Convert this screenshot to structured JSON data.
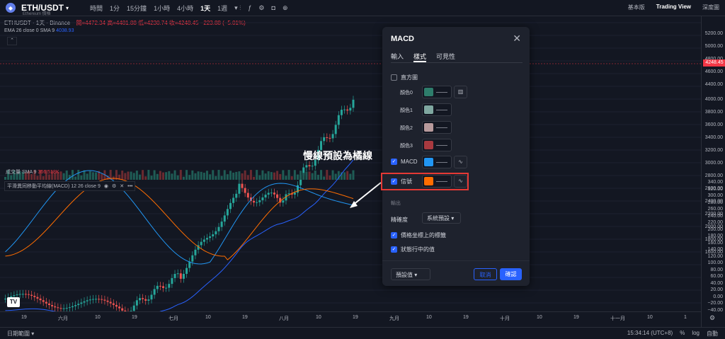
{
  "header": {
    "symbol": "ETH/USDT",
    "symbol_sub": "Ethereum 價格",
    "symbol_icon": "ethereum-logo",
    "timeframes": [
      "時間",
      "1分",
      "15分鐘",
      "1小時",
      "4小時",
      "1天",
      "1週"
    ],
    "active_timeframe": "1天",
    "right": {
      "basic": "基本版",
      "tv": "Trading View",
      "depth": "深度圖"
    }
  },
  "legend": {
    "pair": "ETHUSDT · 1天 · Binance",
    "ohlc": "開=4472.34 高=4481.88 低=4230.74 收=4248.45 −223.88 (−5.01%)",
    "ema": "EMA 26 close 0 SMA 9",
    "ema_value": "4038.93"
  },
  "volume_label": "成交量 SMA 9",
  "volume_value": "366.518K",
  "macd_label": "平滑異同移動平均線(MACD) 12 26 close 9",
  "price_axis": [
    "5200.00",
    "5000.00",
    "4800.00",
    "4600.00",
    "4400.00",
    "4248.45",
    "4000.00",
    "3800.00",
    "3600.00",
    "3400.00",
    "3200.00",
    "3000.00",
    "2800.00",
    "2600.00",
    "2400.00",
    "2200.00",
    "2000.00",
    "1800.00",
    "1600.00",
    "340.00",
    "320.00",
    "300.00",
    "280.00",
    "260.00",
    "240.00",
    "220.00",
    "200.00",
    "180.00",
    "160.00",
    "140.00",
    "120.00",
    "100.00",
    "80.00",
    "60.00",
    "40.00",
    "20.00",
    "0.00",
    "−20.00",
    "−40.00"
  ],
  "current_price": "4248.45",
  "time_axis": [
    "19",
    "六月",
    "10",
    "19",
    "七月",
    "10",
    "19",
    "八月",
    "10",
    "19",
    "九月",
    "10",
    "19",
    "十月",
    "10",
    "19",
    "十一月",
    "10",
    "1"
  ],
  "bottom": {
    "range": "日期範圍",
    "time": "15:34:14 (UTC+8)",
    "pct": "%",
    "log": "log",
    "auto": "自動"
  },
  "dialog": {
    "title": "MACD",
    "tabs": [
      "輸入",
      "樣式",
      "可見性"
    ],
    "active_tab": "樣式",
    "histogram_label": "直方圖",
    "colors": [
      {
        "label": "顏色0",
        "color": "#2e7d6b"
      },
      {
        "label": "顏色1",
        "color": "#7fa7a0"
      },
      {
        "label": "顏色2",
        "color": "#b89a9c"
      },
      {
        "label": "顏色3",
        "color": "#a8393f"
      }
    ],
    "macd_row": {
      "label": "MACD",
      "color": "#2196f3"
    },
    "signal_row": {
      "label": "信號",
      "color": "#ff6d00"
    },
    "output_label": "輸出",
    "precision_label": "精確度",
    "precision_value": "系統預設",
    "check1": "價格坐標上的標籤",
    "check2": "狀態行中的值",
    "defaults": "預設值",
    "cancel": "取消",
    "ok": "確認"
  },
  "annotation": "慢線預設為橘線",
  "colors": {
    "bg": "#131722",
    "up": "#26a69a",
    "down": "#ef5350",
    "macd": "#2196f3",
    "signal": "#ff6d00",
    "ema": "#2962ff",
    "accent": "#2962ff"
  }
}
